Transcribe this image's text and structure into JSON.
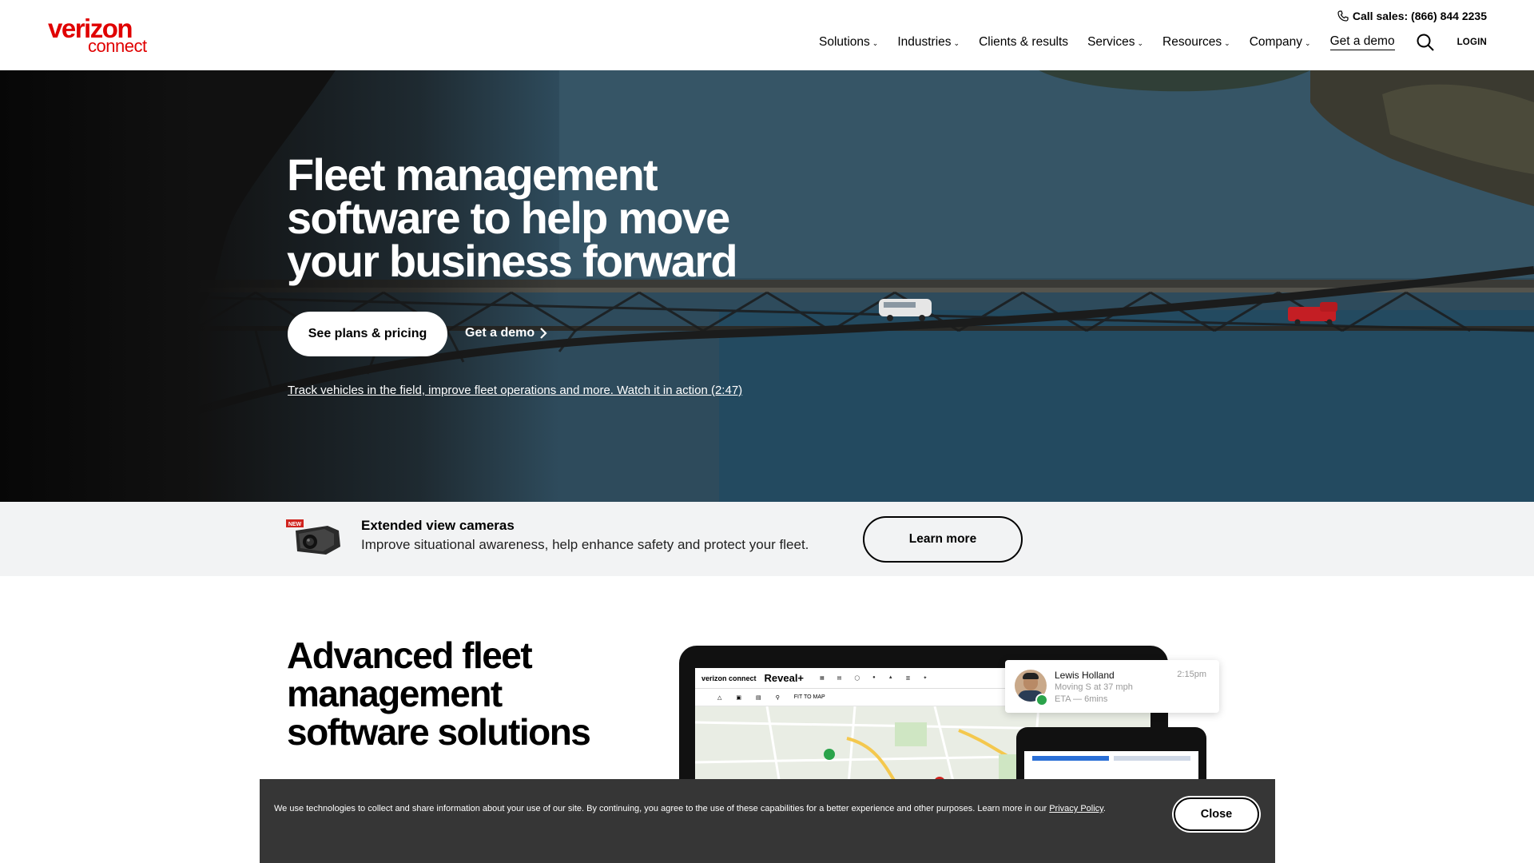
{
  "brand": {
    "name_line1": "verizon",
    "name_line2": "connect",
    "color": "#e00000"
  },
  "header": {
    "call_sales": "Call sales: (866) 844 2235",
    "nav": [
      {
        "label": "Solutions",
        "has_dropdown": true
      },
      {
        "label": "Industries",
        "has_dropdown": true
      },
      {
        "label": "Clients & results",
        "has_dropdown": false
      },
      {
        "label": "Services",
        "has_dropdown": true
      },
      {
        "label": "Resources",
        "has_dropdown": true
      },
      {
        "label": "Company",
        "has_dropdown": true
      },
      {
        "label": "Get a demo",
        "has_dropdown": false
      }
    ],
    "search_icon": "search-icon",
    "login": "LOGIN"
  },
  "hero": {
    "title": "Fleet management software to help move your business forward",
    "primary_button": "See plans & pricing",
    "secondary_button": "Get a demo",
    "video_link": "Track vehicles in the field, improve fleet operations and more. Watch it in action (2:47)"
  },
  "promo": {
    "badge": "NEW",
    "title": "Extended view cameras",
    "description": "Improve situational awareness, help enhance safety and protect your fleet.",
    "button": "Learn more"
  },
  "advanced": {
    "title": "Advanced fleet management software solutions"
  },
  "mockup": {
    "app_brand": "verizon connect",
    "app_name": "Reveal+",
    "toolbar_action": "FIT TO MAP",
    "notification": {
      "name": "Lewis Holland",
      "time": "2:15pm",
      "status": "Moving S at 37 mph",
      "eta": "ETA — 6mins"
    }
  },
  "cookie": {
    "text": "We use technologies to collect and share information about your use of our site. By continuing, you agree to the use of these capabilities for a better experience and other purposes. Learn more in our ",
    "link": "Privacy Policy",
    "text_end": ".",
    "close": "Close"
  }
}
